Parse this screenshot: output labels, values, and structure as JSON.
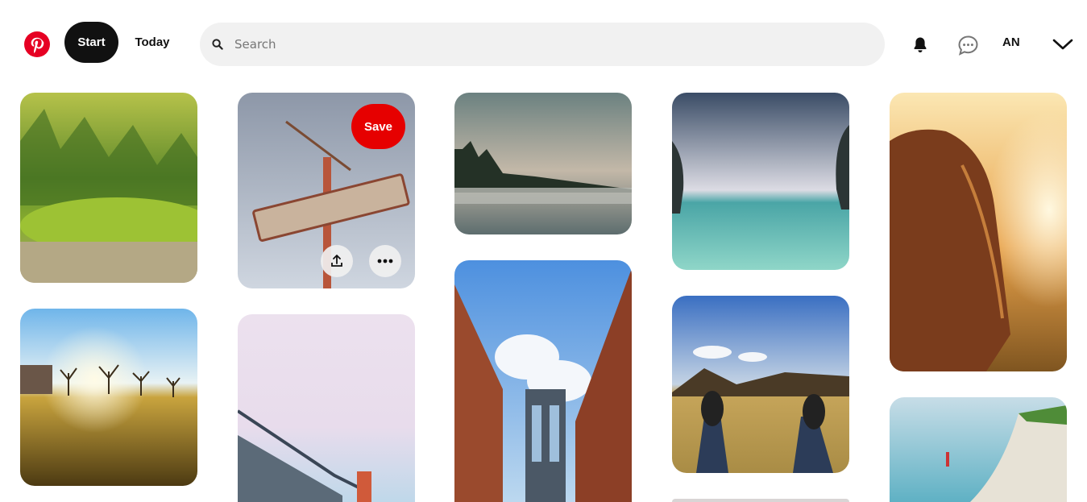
{
  "header": {
    "start_label": "Start",
    "today_label": "Today",
    "search_placeholder": "Search",
    "user_initials": "AN"
  },
  "pin_actions": {
    "save_label": "Save"
  },
  "colors": {
    "brand": "#e60023",
    "save": "#e60000",
    "nav_active": "#111111",
    "search_bg": "#f1f1f1"
  }
}
